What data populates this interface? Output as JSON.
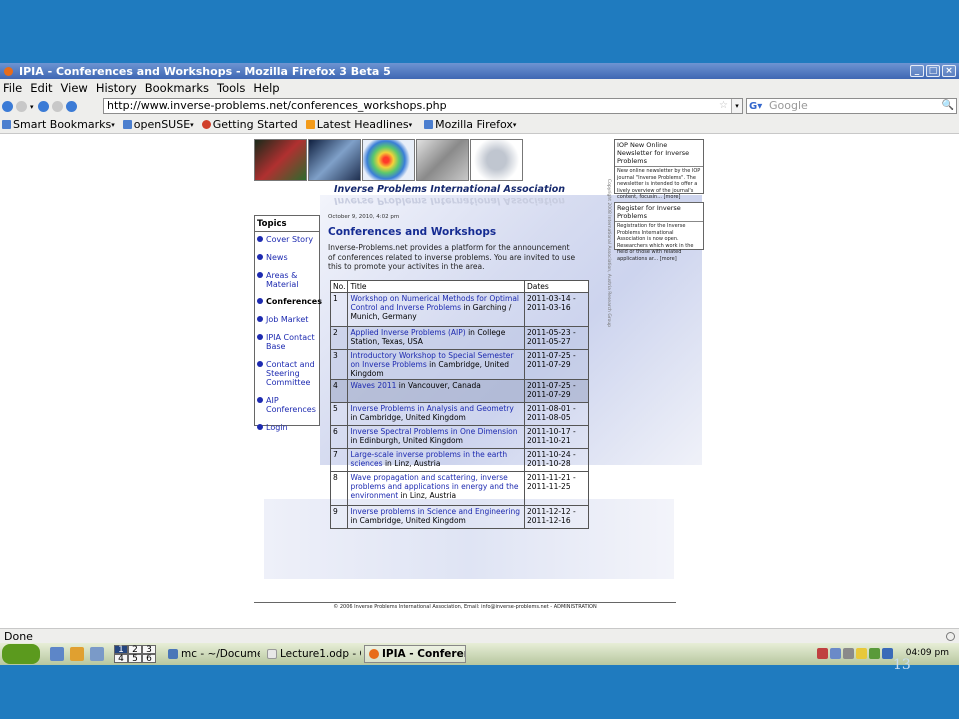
{
  "window": {
    "title": "IPIA - Conferences and Workshops - Mozilla Firefox 3 Beta 5",
    "controls": [
      "_",
      "□",
      "×"
    ]
  },
  "menu": [
    "File",
    "Edit",
    "View",
    "History",
    "Bookmarks",
    "Tools",
    "Help"
  ],
  "nav": {
    "url": "http://www.inverse-problems.net/conferences_workshops.php",
    "search_placeholder": "Google"
  },
  "bookmarks": [
    "Smart Bookmarks",
    "openSUSE",
    "Getting Started",
    "Latest Headlines",
    "Mozilla Firefox"
  ],
  "site": {
    "title": "Inverse Problems International Association",
    "topics_header": "Topics",
    "topics": [
      "Cover Story",
      "News",
      "Areas & Material",
      "Conferences",
      "Job Market",
      "IPIA Contact Base",
      "Contact and Steering Committee",
      "AIP Conferences",
      "Login"
    ],
    "active_topic": "Conferences",
    "date": "October 9, 2010, 4:02 pm",
    "heading": "Conferences and Workshops",
    "intro": "Inverse-Problems.net provides a platform for the announcement of conferences related to inverse problems. You are invited to use this to promote your activites in the area.",
    "table": {
      "headers": [
        "No.",
        "Title",
        "Dates"
      ],
      "rows": [
        {
          "no": "1",
          "link": "Workshop on Numerical Methods for Optimal Control and Inverse Problems",
          "rest": " in Garching / Munich, Germany",
          "dates": "2011-03-14 - 2011-03-16"
        },
        {
          "no": "2",
          "link": "Applied Inverse Problems (AIP)",
          "rest": " in College Station, Texas, USA",
          "dates": "2011-05-23 - 2011-05-27"
        },
        {
          "no": "3",
          "link": "Introductory Workshop to Special Semester on Inverse Problems",
          "rest": " in Cambridge, United Kingdom",
          "dates": "2011-07-25 - 2011-07-29"
        },
        {
          "no": "4",
          "link": "Waves 2011",
          "rest": " in Vancouver, Canada",
          "dates": "2011-07-25 - 2011-07-29"
        },
        {
          "no": "5",
          "link": "Inverse Problems in Analysis and Geometry",
          "rest": " in Cambridge, United Kingdom",
          "dates": "2011-08-01 - 2011-08-05"
        },
        {
          "no": "6",
          "link": "Inverse Spectral Problems in One Dimension",
          "rest": " in Edinburgh, United Kingdom",
          "dates": "2011-10-17 - 2011-10-21"
        },
        {
          "no": "7",
          "link": "Large-scale inverse problems in the earth sciences",
          "rest": " in Linz, Austria",
          "dates": "2011-10-24 - 2011-10-28"
        },
        {
          "no": "8",
          "link": "Wave propagation and scattering, inverse problems and applications in energy and the environment",
          "rest": " in Linz, Austria",
          "dates": "2011-11-21 - 2011-11-25"
        },
        {
          "no": "9",
          "link": "Inverse problems in Science and Engineering",
          "rest": " in Cambridge, United Kingdom",
          "dates": "2011-12-12 - 2011-12-16"
        }
      ]
    },
    "vertical_text": "Copyright 2008 International Association, Austria Research Group",
    "footer": "© 2006 Inverse Problems International Association, Email: info@inverse-problems.net - ADMINISTRATION",
    "sidebar": [
      {
        "title": "IOP New Online Newsletter for Inverse Problems",
        "body": "New online newsletter by the IOP journal \"Inverse Problems\". The newsletter is intended to offer a lively overview of the journal's content, focusin... [more]"
      },
      {
        "title": "Register for Inverse Problems",
        "body": "Registration for the Inverse Problems International Association is now open. Researchers which work in the field or those with related applications ar... [more]"
      }
    ]
  },
  "status": "Done",
  "taskbar": {
    "pager": [
      "1",
      "2",
      "3",
      "4",
      "5",
      "6"
    ],
    "tasks": [
      "mc - ~/Documents",
      "Lecture1.odp - Op",
      "IPIA - Conference"
    ],
    "clock": "04:09 pm"
  },
  "slide_number": "13"
}
